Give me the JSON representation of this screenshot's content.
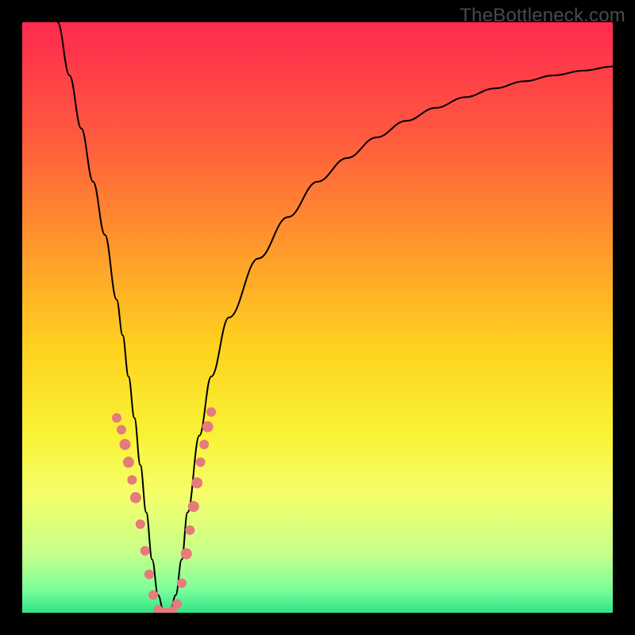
{
  "watermark": "TheBottleneck.com",
  "chart_data": {
    "type": "line",
    "title": "",
    "xlabel": "",
    "ylabel": "",
    "xlim": [
      0,
      100
    ],
    "ylim": [
      0,
      100
    ],
    "grid": false,
    "legend": false,
    "background_gradient": {
      "stops": [
        {
          "offset": 0.0,
          "color": "#ff2a4f"
        },
        {
          "offset": 0.18,
          "color": "#ff5640"
        },
        {
          "offset": 0.35,
          "color": "#ff8e2e"
        },
        {
          "offset": 0.55,
          "color": "#ffd21f"
        },
        {
          "offset": 0.7,
          "color": "#f8f337"
        },
        {
          "offset": 0.8,
          "color": "#f5ff6a"
        },
        {
          "offset": 0.9,
          "color": "#c6ff8a"
        },
        {
          "offset": 0.96,
          "color": "#7dff9a"
        },
        {
          "offset": 1.0,
          "color": "#33e28a"
        }
      ]
    },
    "series": [
      {
        "name": "bottleneck-curve",
        "color": "#000000",
        "stroke_width": 2,
        "x": [
          6,
          8,
          10,
          12,
          14,
          16,
          17,
          18,
          19,
          20,
          21,
          22,
          23,
          24,
          25,
          26,
          27,
          28,
          30,
          32,
          35,
          40,
          45,
          50,
          55,
          60,
          65,
          70,
          75,
          80,
          85,
          90,
          95,
          100
        ],
        "y": [
          100,
          91,
          82,
          73,
          64,
          53,
          47,
          40,
          33,
          25,
          17,
          9,
          3,
          0,
          0,
          3,
          9,
          17,
          30,
          40,
          50,
          60,
          67,
          73,
          77,
          80.5,
          83.3,
          85.5,
          87.3,
          88.8,
          90,
          91,
          91.8,
          92.5
        ]
      }
    ],
    "marker_clusters": [
      {
        "name": "left-arm-markers",
        "color": "#e77a7a",
        "points": [
          {
            "x": 16.0,
            "y": 33.0,
            "r": 6
          },
          {
            "x": 16.8,
            "y": 31.0,
            "r": 6
          },
          {
            "x": 17.4,
            "y": 28.5,
            "r": 7
          },
          {
            "x": 18.0,
            "y": 25.5,
            "r": 7
          },
          {
            "x": 18.6,
            "y": 22.5,
            "r": 6
          },
          {
            "x": 19.2,
            "y": 19.5,
            "r": 7
          },
          {
            "x": 20.0,
            "y": 15.0,
            "r": 6
          },
          {
            "x": 20.8,
            "y": 10.5,
            "r": 6
          },
          {
            "x": 21.5,
            "y": 6.5,
            "r": 6
          },
          {
            "x": 22.2,
            "y": 3.0,
            "r": 6
          }
        ]
      },
      {
        "name": "trough-markers",
        "color": "#e77a7a",
        "points": [
          {
            "x": 23.0,
            "y": 0.5,
            "r": 6
          },
          {
            "x": 23.8,
            "y": 0.0,
            "r": 6
          },
          {
            "x": 24.6,
            "y": 0.0,
            "r": 6
          },
          {
            "x": 25.4,
            "y": 0.3,
            "r": 6
          },
          {
            "x": 26.2,
            "y": 1.5,
            "r": 6
          }
        ]
      },
      {
        "name": "right-arm-markers",
        "color": "#e77a7a",
        "points": [
          {
            "x": 27.0,
            "y": 5.0,
            "r": 6
          },
          {
            "x": 27.8,
            "y": 10.0,
            "r": 7
          },
          {
            "x": 28.4,
            "y": 14.0,
            "r": 6
          },
          {
            "x": 29.0,
            "y": 18.0,
            "r": 7
          },
          {
            "x": 29.6,
            "y": 22.0,
            "r": 7
          },
          {
            "x": 30.2,
            "y": 25.5,
            "r": 6
          },
          {
            "x": 30.8,
            "y": 28.5,
            "r": 6
          },
          {
            "x": 31.4,
            "y": 31.5,
            "r": 7
          },
          {
            "x": 32.0,
            "y": 34.0,
            "r": 6
          }
        ]
      }
    ]
  }
}
